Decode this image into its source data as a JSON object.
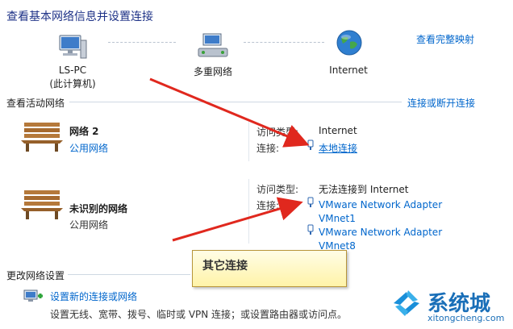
{
  "page_title": "查看基本网络信息并设置连接",
  "map": {
    "view_full_map": "查看完整映射",
    "nodes": [
      {
        "name": "LS-PC",
        "sub": "(此计算机)"
      },
      {
        "name": "多重网络",
        "sub": ""
      },
      {
        "name": "Internet",
        "sub": ""
      }
    ]
  },
  "active": {
    "header": "查看活动网络",
    "connect_link": "连接或断开连接",
    "networks": [
      {
        "name": "网络  2",
        "type": "公用网络",
        "access_label": "访问类型:",
        "access_value": "Internet",
        "conn_label": "连接:",
        "connections": [
          "本地连接"
        ]
      },
      {
        "name": "未识别的网络",
        "type": "公用网络",
        "access_label": "访问类型:",
        "access_value": "无法连接到 Internet",
        "conn_label": "连接:",
        "connections": [
          "VMware Network Adapter VMnet1",
          "VMware Network Adapter VMnet8"
        ]
      }
    ]
  },
  "callout": "其它连接",
  "change": {
    "header": "更改网络设置",
    "item_title": "设置新的连接或网络",
    "item_desc": "设置无线、宽带、拨号、临时或 VPN 连接；或设置路由器或访问点。"
  },
  "watermark": {
    "brand": "系统城",
    "url": "xitongcheng.com"
  },
  "colors": {
    "title": "#1e3287",
    "link": "#0066cc",
    "arrow": "#e0281e",
    "callout_bg": "#fff3a8"
  }
}
